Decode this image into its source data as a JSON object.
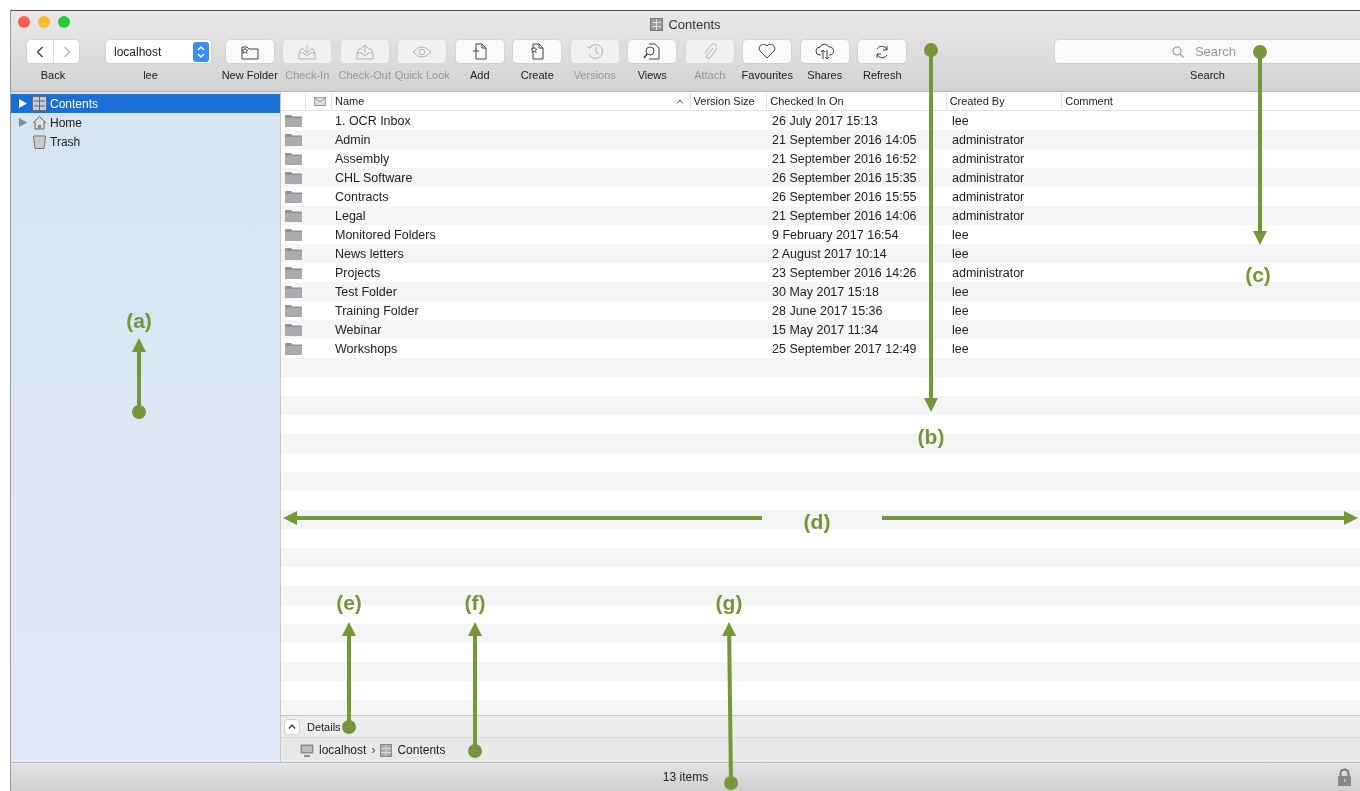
{
  "window": {
    "title": "Contents"
  },
  "toolbar": {
    "back": {
      "label": "Back"
    },
    "server": {
      "value": "localhost",
      "label": "lee"
    },
    "buttons": [
      {
        "label": "New Folder",
        "disabled": false
      },
      {
        "label": "Check-In",
        "disabled": true
      },
      {
        "label": "Check-Out",
        "disabled": true
      },
      {
        "label": "Quick Look",
        "disabled": true
      },
      {
        "label": "Add",
        "disabled": false
      },
      {
        "label": "Create",
        "disabled": false
      },
      {
        "label": "Versions",
        "disabled": true
      },
      {
        "label": "Views",
        "disabled": false
      },
      {
        "label": "Attach",
        "disabled": true
      },
      {
        "label": "Favourites",
        "disabled": false
      },
      {
        "label": "Shares",
        "disabled": false
      },
      {
        "label": "Refresh",
        "disabled": false
      }
    ],
    "search": {
      "placeholder": "Search",
      "label": "Search"
    }
  },
  "sidebar": {
    "items": [
      {
        "label": "Contents",
        "selected": true,
        "disclosure": true
      },
      {
        "label": "Home",
        "selected": false,
        "disclosure": true
      },
      {
        "label": "Trash",
        "selected": false,
        "disclosure": false
      }
    ]
  },
  "table": {
    "columns": [
      {
        "label": "Name",
        "sorted": true
      },
      {
        "label": "Version Size",
        "sorted": false
      },
      {
        "label": "Checked In On",
        "sorted": false
      },
      {
        "label": "Created By",
        "sorted": false
      },
      {
        "label": "Comment",
        "sorted": false
      }
    ],
    "rows": [
      {
        "name": "1. OCR Inbox",
        "checked_in_on": "26 July 2017 15:13",
        "created_by": "lee"
      },
      {
        "name": "Admin",
        "checked_in_on": "21 September 2016 14:05",
        "created_by": "administrator"
      },
      {
        "name": "Assembly",
        "checked_in_on": "21 September 2016 16:52",
        "created_by": "administrator"
      },
      {
        "name": "CHL Software",
        "checked_in_on": "26 September 2016 15:35",
        "created_by": "administrator"
      },
      {
        "name": "Contracts",
        "checked_in_on": "26 September 2016 15:55",
        "created_by": "administrator"
      },
      {
        "name": "Legal",
        "checked_in_on": "21 September 2016 14:06",
        "created_by": "administrator"
      },
      {
        "name": "Monitored Folders",
        "checked_in_on": "9 February 2017 16:54",
        "created_by": "lee"
      },
      {
        "name": "News letters",
        "checked_in_on": "2 August 2017 10:14",
        "created_by": "lee"
      },
      {
        "name": "Projects",
        "checked_in_on": "23 September 2016 14:26",
        "created_by": "administrator"
      },
      {
        "name": "Test Folder",
        "checked_in_on": "30 May 2017 15:18",
        "created_by": "lee"
      },
      {
        "name": "Training Folder",
        "checked_in_on": "28 June 2017 15:36",
        "created_by": "lee"
      },
      {
        "name": "Webinar",
        "checked_in_on": "15 May 2017 11:34",
        "created_by": "lee"
      },
      {
        "name": "Workshops",
        "checked_in_on": "25 September 2017 12:49",
        "created_by": "lee"
      }
    ]
  },
  "details": {
    "label": "Details"
  },
  "path": {
    "separator": "›",
    "items": [
      "localhost",
      "Contents"
    ]
  },
  "status_bar": {
    "text": "13 items"
  },
  "annotations": [
    "(a)",
    "(b)",
    "(c)",
    "(d)",
    "(e)",
    "(f)",
    "(g)"
  ]
}
